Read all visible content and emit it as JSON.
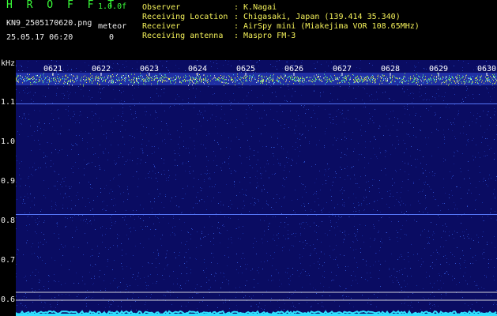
{
  "header": {
    "app_name": "H R O F F T",
    "version": "1.0.0f",
    "filename": "KN9_2505170620.png",
    "meteor_label": "meteor",
    "meteor_count": "0",
    "datetime": "25.05.17 06:20",
    "info": [
      {
        "key": "Observer",
        "value": ": K.Nagai"
      },
      {
        "key": "Receiving Location",
        "value": ": Chigasaki, Japan (139.414 35.340)"
      },
      {
        "key": "Receiver",
        "value": ": AirSpy mini (Miakejima VOR 108.65MHz)"
      },
      {
        "key": "Receiving antenna",
        "value": ": Maspro FM-3"
      }
    ]
  },
  "chart_data": {
    "type": "heatmap",
    "ylabel": "kHz",
    "ylim": [
      0.6,
      1.2
    ],
    "yticks": [
      "1.1",
      "1.0",
      "0.9",
      "0.8",
      "0.7",
      "0.6"
    ],
    "x_ticks": [
      "0621",
      "0622",
      "0623",
      "0624",
      "0625",
      "0626",
      "0627",
      "0628",
      "0629",
      "0630"
    ],
    "carrier_khz": 1.16,
    "lines_khz": [
      1.097,
      0.817,
      0.62,
      0.6
    ]
  },
  "colors": {
    "background": "#0a0c62",
    "carrier": "#e0ff40",
    "signal": "#30e0ff",
    "header_green": "#3aff3a",
    "header_yellow": "#f3f05a"
  }
}
